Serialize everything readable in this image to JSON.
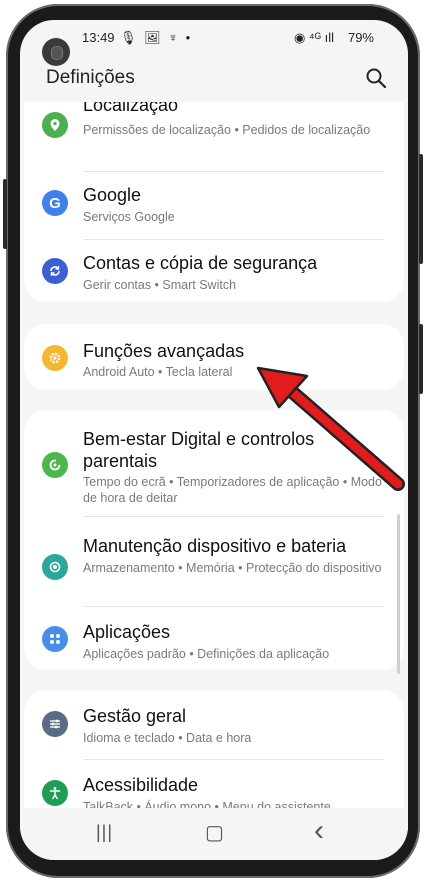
{
  "status_bar": {
    "time": "13:49",
    "battery": "79%",
    "notif_icons": "🎙 🖼 ♆ •",
    "right_icons": "◉ ⁴ᴳ ıll"
  },
  "header": {
    "title": "Definições"
  },
  "items": [
    {
      "title": "Localização",
      "subtitle": "Permissões de localização  •  Pedidos de localização",
      "icon": "location-icon",
      "color": "#4caf50"
    },
    {
      "title": "Google",
      "subtitle": "Serviços Google",
      "icon": "google-icon",
      "color": "#3f80ea"
    },
    {
      "title": "Contas e cópia de segurança",
      "subtitle": "Gerir contas  •  Smart Switch",
      "icon": "sync-icon",
      "color": "#3d5fd6"
    },
    {
      "title": "Funções avançadas",
      "subtitle": "Android Auto  •  Tecla lateral",
      "icon": "gear-star-icon",
      "color": "#f5b731"
    },
    {
      "title": "Bem-estar Digital e controlos parentais",
      "subtitle": "Tempo do ecrã  •  Temporizadores de aplicação  •  Modo de hora de deitar",
      "icon": "wellbeing-icon",
      "color": "#4cb84c"
    },
    {
      "title": "Manutenção dispositivo e bateria",
      "subtitle": "Armazenamento  •  Memória  •  Protecção do dispositivo",
      "icon": "maintenance-icon",
      "color": "#2aa89a"
    },
    {
      "title": "Aplicações",
      "subtitle": "Aplicações padrão  •  Definições da aplicação",
      "icon": "apps-icon",
      "color": "#4a8de8"
    },
    {
      "title": "Gestão geral",
      "subtitle": "Idioma e teclado  •  Data e hora",
      "icon": "sliders-icon",
      "color": "#5a6c85"
    },
    {
      "title": "Acessibilidade",
      "subtitle": "TalkBack  •  Áudio mono  •  Menu do assistente",
      "icon": "accessibility-icon",
      "color": "#1f9d55"
    }
  ],
  "nav": {
    "recents": "|||",
    "home": "▢",
    "back": "‹"
  },
  "annotation": {
    "arrow_color": "#e21c1c"
  }
}
